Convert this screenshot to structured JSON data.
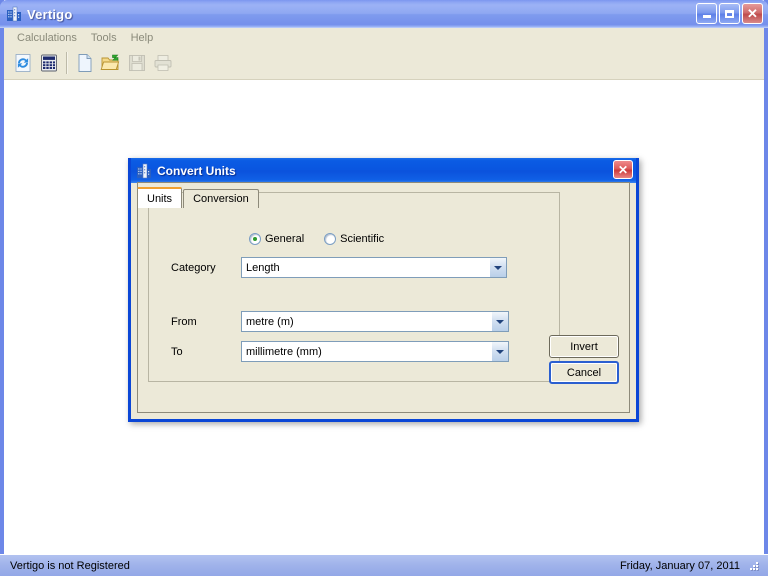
{
  "window": {
    "title": "Vertigo",
    "icon": "building-icon",
    "controls": {
      "minimize": "minimize-icon",
      "maximize": "maximize-icon",
      "close": "close-icon"
    }
  },
  "menu": {
    "items": [
      {
        "label": "Calculations"
      },
      {
        "label": "Tools"
      },
      {
        "label": "Help"
      }
    ]
  },
  "toolbar": {
    "buttons": [
      {
        "name": "convert-units-button",
        "icon": "refresh-convert-icon",
        "enabled": true
      },
      {
        "name": "calculator-button",
        "icon": "calculator-icon",
        "enabled": true
      },
      {
        "name": "new-file-button",
        "icon": "new-document-icon",
        "enabled": true
      },
      {
        "name": "open-file-button",
        "icon": "open-folder-icon",
        "enabled": true
      },
      {
        "name": "save-file-button",
        "icon": "save-disk-icon",
        "enabled": false
      },
      {
        "name": "print-button",
        "icon": "printer-icon",
        "enabled": false
      }
    ]
  },
  "statusbar": {
    "left_text": "Vertigo is not Registered",
    "right_text": "Friday, January 07, 2011"
  },
  "dialog": {
    "title": "Convert Units",
    "icon": "building-icon",
    "close_label": "✕",
    "tabs": [
      {
        "label": "Units",
        "active": true
      },
      {
        "label": "Conversion",
        "active": false
      }
    ],
    "mode": {
      "general_label": "General",
      "scientific_label": "Scientific",
      "selected": "General"
    },
    "fields": [
      {
        "label": "Category",
        "value": "Length"
      },
      {
        "label": "From",
        "value": "metre (m)"
      },
      {
        "label": "To",
        "value": "millimetre (mm)"
      }
    ],
    "buttons": {
      "invert_label": "Invert",
      "cancel_label": "Cancel"
    }
  },
  "colors": {
    "active_titlebar": "#0a56e0",
    "inactive_titlebar": "#8fa8f2",
    "dialog_border": "#0a46d6",
    "face": "#ece9d8",
    "tab_accent": "#f0a030",
    "radio_dot": "#2f9b2f"
  }
}
